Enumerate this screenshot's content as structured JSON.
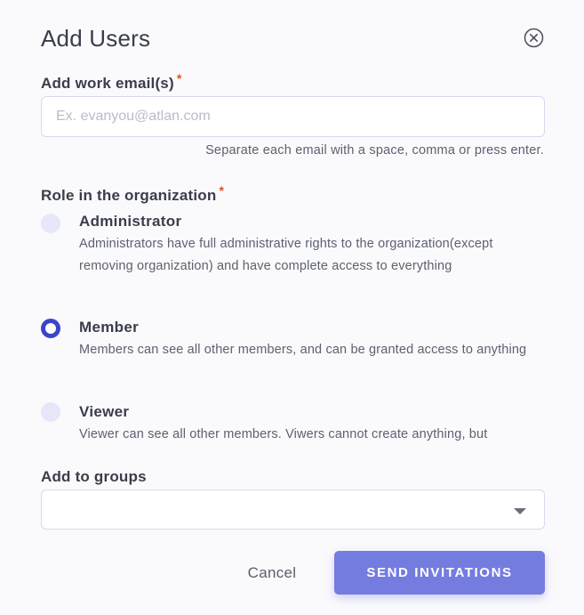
{
  "dialog": {
    "title": "Add Users",
    "close_icon": "close-circle-icon"
  },
  "email": {
    "label": "Add work email(s)",
    "required_mark": "*",
    "placeholder": "Ex. evanyou@atlan.com",
    "value": "",
    "hint": "Separate each email with a space, comma or press enter."
  },
  "role": {
    "label": "Role in the organization",
    "required_mark": "*",
    "selected": "Member",
    "options": [
      {
        "title": "Administrator",
        "description": "Administrators have full administrative rights to the organization(except removing organization) and have complete access to everything",
        "checked": false
      },
      {
        "title": "Member",
        "description": "Members can see all other members, and can be granted access to anything",
        "checked": true
      },
      {
        "title": "Viewer",
        "description": "Viewer can see all other members. Viwers cannot create anything, but",
        "checked": false
      }
    ]
  },
  "groups": {
    "label": "Add to groups",
    "value": "",
    "caret_icon": "caret-down-icon"
  },
  "actions": {
    "cancel_label": "Cancel",
    "send_label": "SEND INVITATIONS"
  },
  "colors": {
    "accent": "#3b45c9",
    "button": "#747ce0",
    "required": "#e0531f",
    "radio_unchecked": "#e6e7f8",
    "border": "#d6d8f3"
  }
}
